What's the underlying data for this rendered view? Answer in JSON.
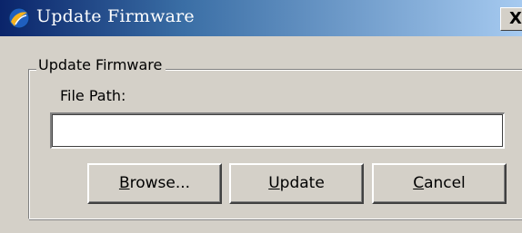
{
  "window": {
    "title": "Update Firmware",
    "close_label": "X"
  },
  "group": {
    "legend": "Update Firmware"
  },
  "file_path": {
    "label": "File Path:",
    "value": ""
  },
  "buttons": {
    "browse": {
      "mnemonic": "B",
      "rest": "rowse..."
    },
    "update": {
      "mnemonic": "U",
      "rest": "pdate"
    },
    "cancel": {
      "mnemonic": "C",
      "rest": "ancel"
    }
  },
  "icons": {
    "app": "firmware-app-icon",
    "close": "close-icon"
  },
  "colors": {
    "titlebar_start": "#0a246a",
    "titlebar_end": "#a6caf0",
    "dialog_face": "#d4d0c8"
  }
}
